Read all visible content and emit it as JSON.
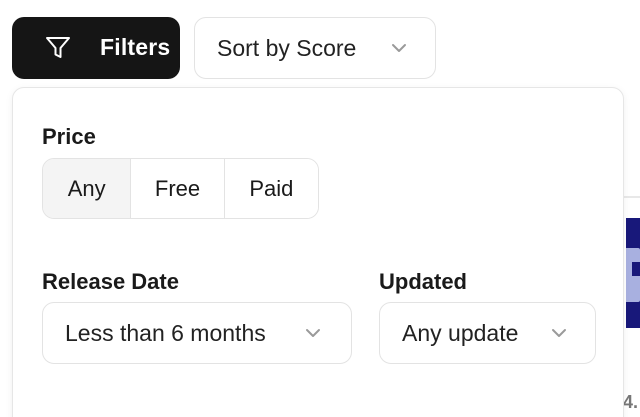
{
  "toolbar": {
    "filters_label": "Filters",
    "sort_label": "Sort by Score"
  },
  "panel": {
    "price": {
      "label": "Price",
      "options": [
        "Any",
        "Free",
        "Paid"
      ],
      "selected": "Any"
    },
    "release_date": {
      "label": "Release Date",
      "value": "Less than 6 months"
    },
    "updated": {
      "label": "Updated",
      "value": "Any update"
    }
  },
  "background": {
    "partial_text": "4."
  },
  "colors": {
    "primary_button": "#151515",
    "border": "#e3e3e3",
    "active_segment": "#f4f4f4",
    "background_card": "#18187a"
  },
  "icons": {
    "filter": "filter-funnel-icon",
    "chevron": "chevron-down-icon"
  }
}
